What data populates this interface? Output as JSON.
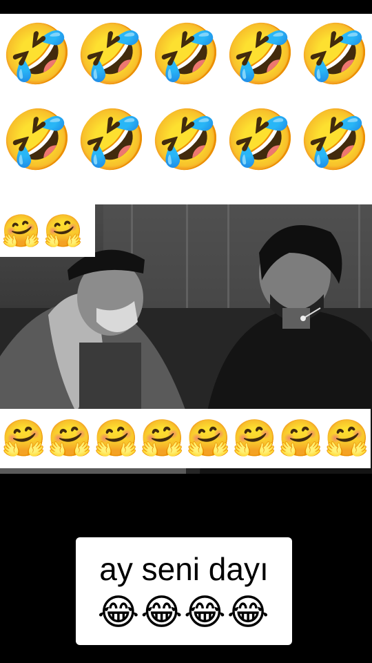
{
  "top_rows": {
    "row1": [
      "🤣",
      "🤣",
      "🤣",
      "🤣",
      "🤣"
    ],
    "row2": [
      "🤣",
      "🤣",
      "🤣",
      "🤣",
      "🤣"
    ]
  },
  "hug_small": [
    "🤗",
    "🤗"
  ],
  "hug_wide": [
    "🤗",
    "🤗",
    "🤗",
    "🤗",
    "🤗",
    "🤗",
    "🤗",
    "🤗"
  ],
  "caption": {
    "text": "ay seni dayı",
    "emojis": "😂😂😂😂"
  }
}
